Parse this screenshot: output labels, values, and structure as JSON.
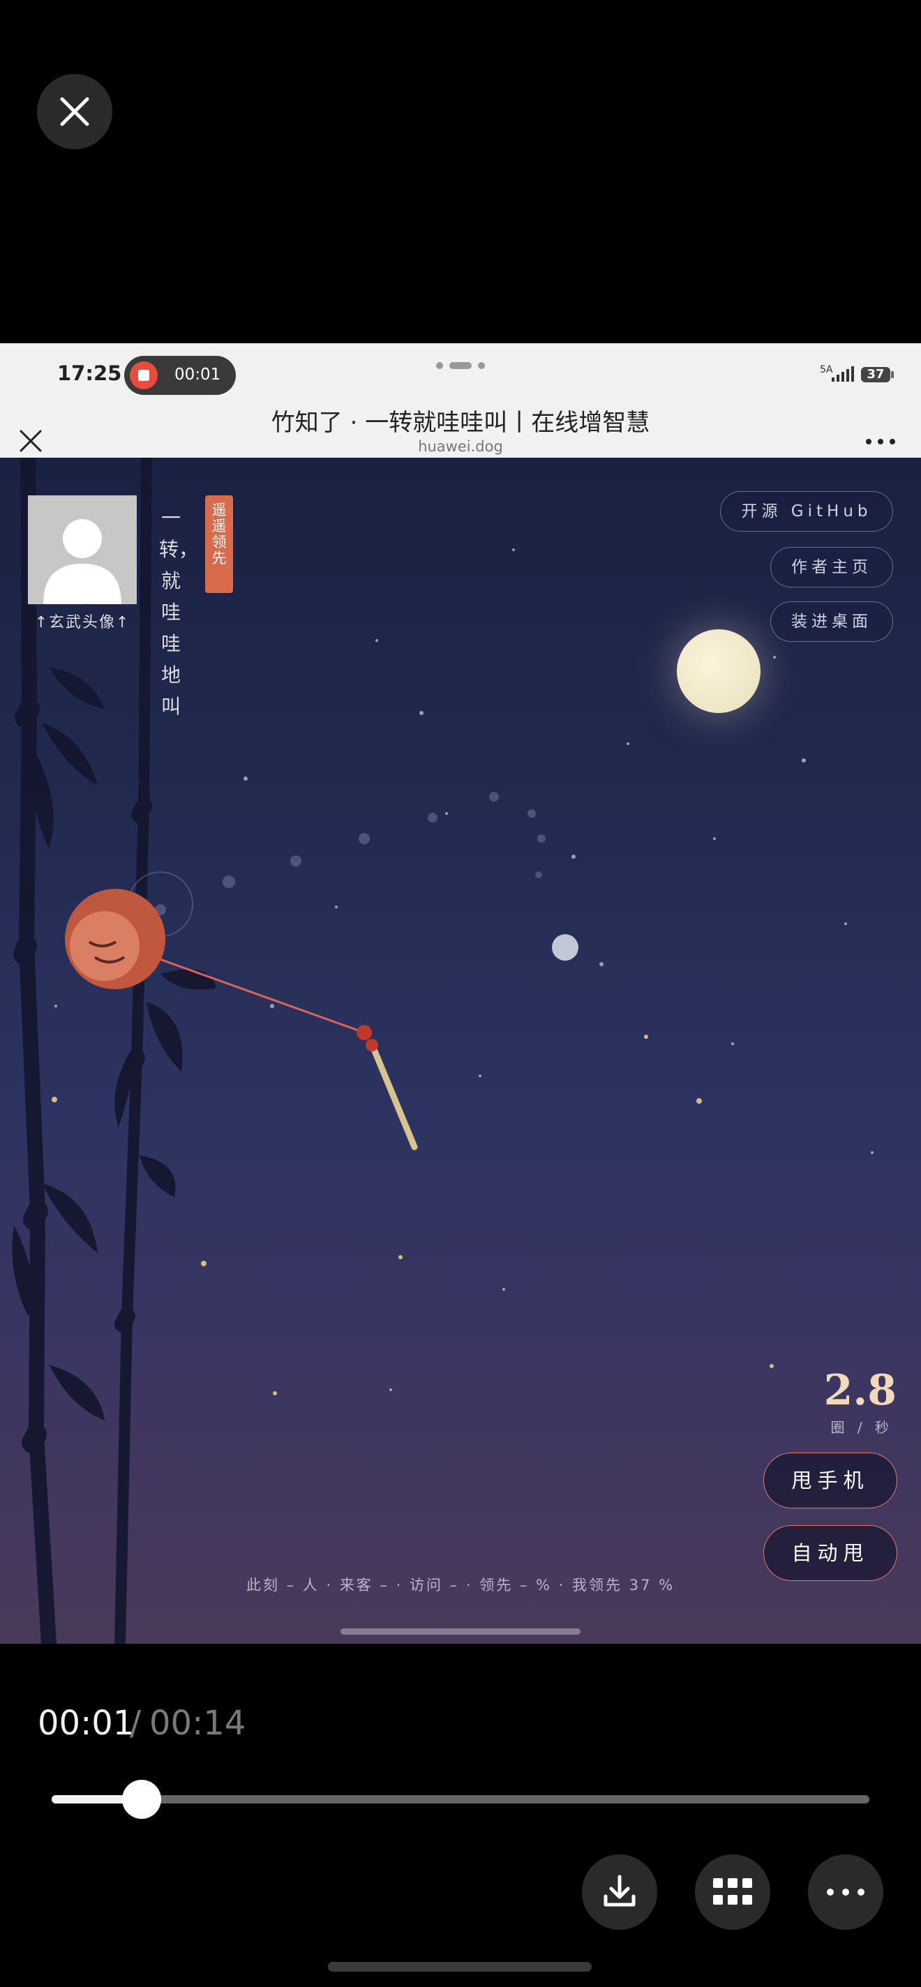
{
  "viewer": {
    "close_icon": "close-icon"
  },
  "status_bar": {
    "time": "17:25",
    "recording_time": "00:01",
    "network": "5A",
    "battery": "37"
  },
  "browser": {
    "title": "竹知了 · 一转就哇哇叫丨在线增智慧",
    "url": "huawei.dog"
  },
  "scene": {
    "avatar_label": "↑玄武头像↑",
    "slogan": "一转，就哇哇地叫",
    "lead_tag": "遥遥领先",
    "buttons": {
      "github": "开源 GitHub",
      "author": "作者主页",
      "desktop": "装进桌面"
    },
    "speed": {
      "value": "2.8",
      "unit": "圈 / 秒"
    },
    "actions": {
      "shake": "甩手机",
      "auto": "自动甩"
    },
    "stats": "此刻 – 人 · 来客 – · 访问 – · 领先 – % · 我领先 37 %"
  },
  "video": {
    "current_time": "00:01",
    "separator": "/",
    "total_time": "00:14",
    "progress": 0.11
  },
  "actions": {
    "download_icon": "download-icon",
    "grid_icon": "grid-icon",
    "more_icon": "more-icon"
  },
  "colors": {
    "accent_red": "#d96b4d",
    "speed_color": "#f3d9b8",
    "sky_top": "#1a2142",
    "sky_bottom": "#4a3a5a"
  }
}
